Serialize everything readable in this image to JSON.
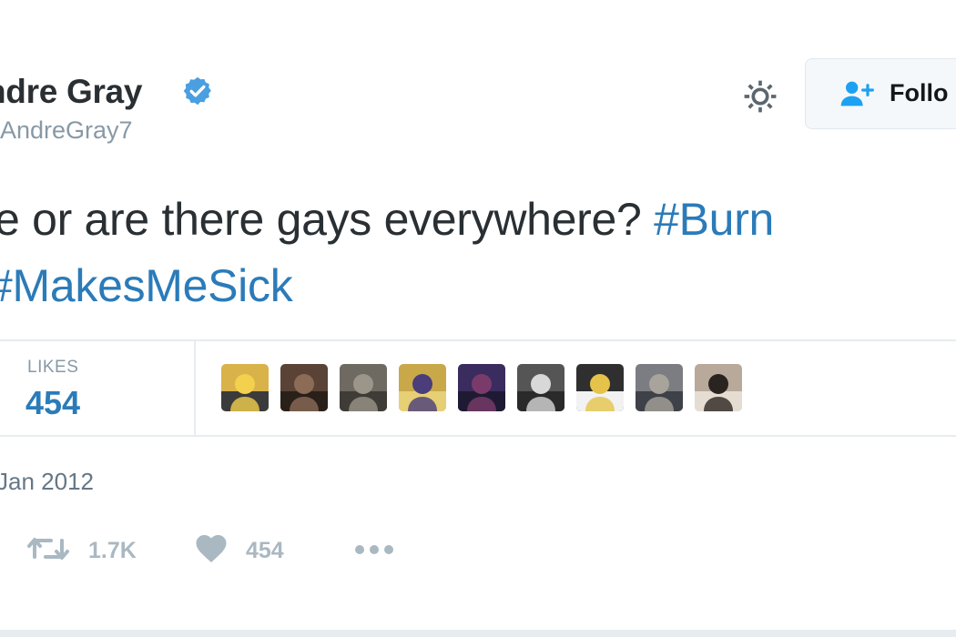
{
  "user": {
    "display_name": "ndre Gray",
    "handle": "AndreGray7",
    "verified": true
  },
  "header": {
    "settings_icon": "gear-icon",
    "follow_icon": "add-user-icon",
    "follow_label": "Follo"
  },
  "tweet": {
    "line1_text": "e or are there gays everywhere? ",
    "line1_hashtag": "#Burn",
    "line2_hashtag": "#MakesMeSick"
  },
  "stats": {
    "likes_label": "LIKES",
    "likes_count": "454"
  },
  "likers": [
    {
      "colors": [
        "#d9b24a",
        "#f3d04e",
        "#3b3b3b"
      ]
    },
    {
      "colors": [
        "#5a4336",
        "#8c6b57",
        "#2a201a"
      ]
    },
    {
      "colors": [
        "#6e6a62",
        "#9b958a",
        "#3f3c37"
      ]
    },
    {
      "colors": [
        "#c9a84a",
        "#4b3c7a",
        "#e7cf76"
      ]
    },
    {
      "colors": [
        "#3a2c5e",
        "#7a3b6b",
        "#1e1a33"
      ]
    },
    {
      "colors": [
        "#555555",
        "#d8d8d8",
        "#2a2a2a"
      ]
    },
    {
      "colors": [
        "#2f2f2f",
        "#e5c34a",
        "#f2f2f2"
      ]
    },
    {
      "colors": [
        "#7b7d82",
        "#a8a39b",
        "#3e4148"
      ]
    },
    {
      "colors": [
        "#b9a99a",
        "#2a2420",
        "#e5ddd2"
      ]
    }
  ],
  "meta": {
    "date": "Jan 2012"
  },
  "actions": {
    "retweet_icon": "retweet-icon",
    "retweet_count": "1.7K",
    "like_icon": "heart-icon",
    "like_count": "454",
    "more_icon": "more-icon"
  },
  "colors": {
    "hashtag": "#2b7bb9",
    "verified": "#1da1f2",
    "muted": "#8899a6"
  }
}
